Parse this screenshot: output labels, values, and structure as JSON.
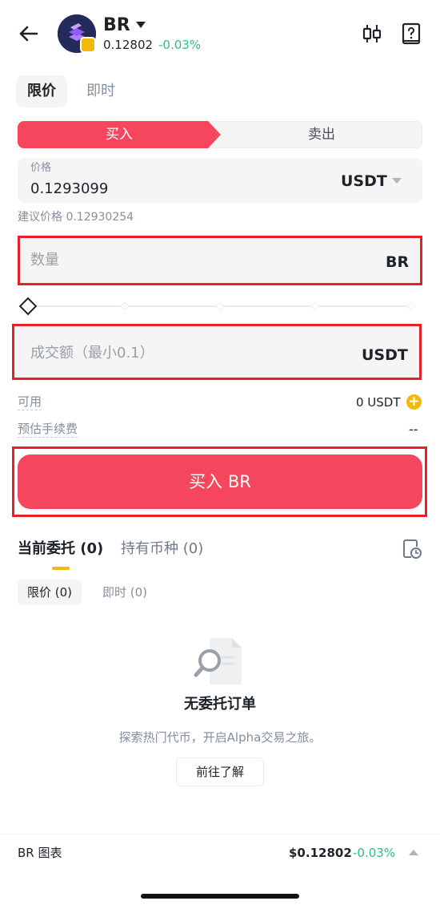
{
  "header": {
    "symbol": "BR",
    "price": "0.12802",
    "change": "-0.03%",
    "icons": [
      "back-arrow-icon",
      "coin-logo",
      "candlestick-chart-icon",
      "help-book-icon"
    ]
  },
  "order_type_tabs": [
    {
      "label": "限价",
      "active": true
    },
    {
      "label": "即时",
      "active": false
    }
  ],
  "side_toggle": {
    "buy_label": "买入",
    "sell_label": "卖出",
    "active": "buy"
  },
  "price_field": {
    "label": "价格",
    "value": "0.1293099",
    "unit": "USDT"
  },
  "suggested_price": "建议价格 0.12930254",
  "amount_field": {
    "placeholder": "数量",
    "unit": "BR"
  },
  "slider": {
    "value_percent": 0,
    "stops": [
      0,
      25,
      50,
      75,
      100
    ]
  },
  "total_field": {
    "placeholder": "成交额（最小0.1）",
    "unit": "USDT"
  },
  "available": {
    "label": "可用",
    "value": "0 USDT"
  },
  "fee": {
    "label": "预估手续费",
    "value": "--"
  },
  "buy_button": "买入 BR",
  "orders": {
    "tabs": [
      {
        "label": "当前委托 (0)",
        "active": true
      },
      {
        "label": "持有币种 (0)",
        "active": false
      }
    ],
    "sub_tabs": [
      {
        "label": "限价 (0)",
        "active": true
      },
      {
        "label": "即时 (0)",
        "active": false
      }
    ],
    "empty": {
      "title": "无委托订单",
      "description": "探索热门代币，开启Alpha交易之旅。",
      "button": "前往了解"
    }
  },
  "bottom_bar": {
    "title": "BR 图表",
    "price": "$0.12802",
    "change": "-0.03%"
  },
  "colors": {
    "buy": "#f6465d",
    "up_green": "#2ebd85",
    "accent": "#f0b90b",
    "highlight_border": "#e8202a"
  }
}
